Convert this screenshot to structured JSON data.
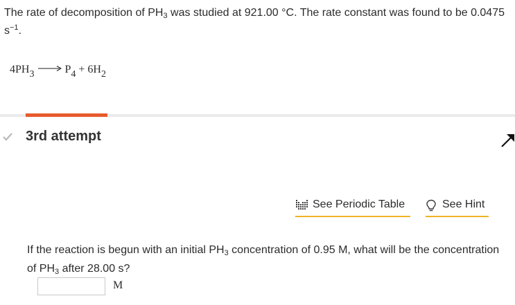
{
  "problem": {
    "intro_a": "The rate of decomposition of PH",
    "intro_sub": "3",
    "intro_b": " was studied at 921.00 °C. The rate constant was found to be 0.0475 s",
    "intro_sup": "−1",
    "intro_c": "."
  },
  "equation": {
    "reactant_coef": "4PH",
    "reactant_sub": "3",
    "product1": "P",
    "product1_sub": "4",
    "plus": " + 6H",
    "product2_sub": "2"
  },
  "attempt": {
    "label": "3rd attempt",
    "progress_fraction": 0.16
  },
  "tools": {
    "periodic_label": "See Periodic Table",
    "hint_label": "See Hint",
    "underline_color": "#f0b323"
  },
  "question": {
    "text_a": "If the reaction is begun with an initial PH",
    "sub_a": "3",
    "text_b": " concentration of 0.95 M, what will be the concentration of PH",
    "sub_b": "3",
    "text_c": " after 28.00  s?"
  },
  "answer": {
    "value": "",
    "unit": "M"
  },
  "colors": {
    "accent": "#e85a2c",
    "divider": "#ebebeb"
  }
}
